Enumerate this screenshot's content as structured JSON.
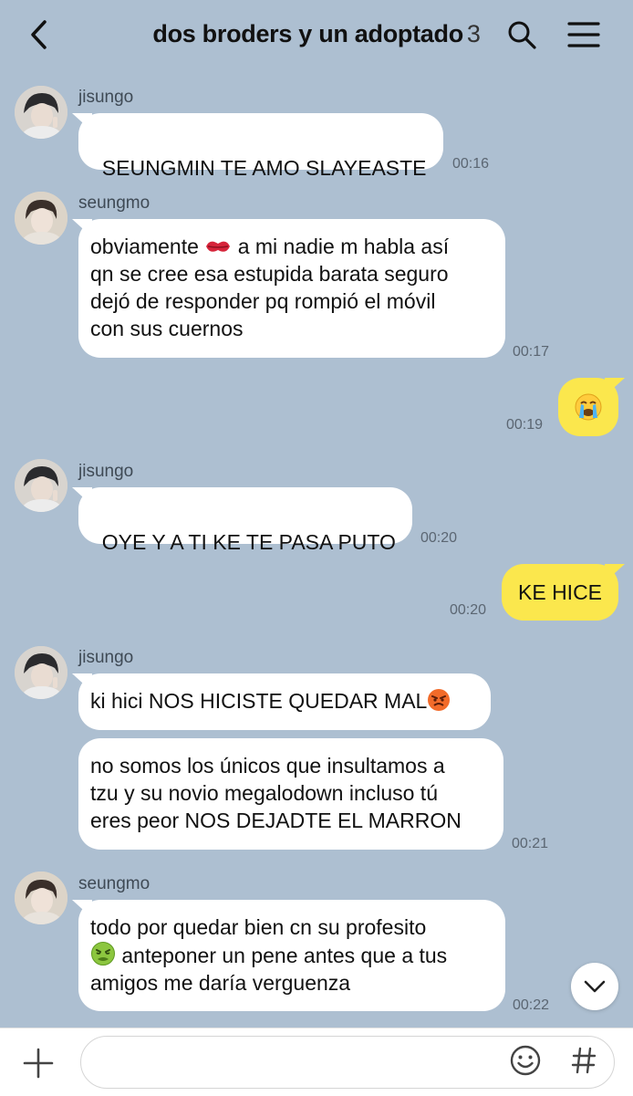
{
  "header": {
    "title": "dos broders y un adoptado",
    "member_count": "3"
  },
  "messages": [
    {
      "sender": "jisungo",
      "text": "SEUNGMIN TE AMO SLAYEASTE",
      "time": "00:16"
    },
    {
      "sender": "seungmo",
      "text_before_emoji": "obviamente ",
      "emoji": "kiss-mark",
      "text_after_emoji": " a mi nadie m habla así\nqn se cree esa estupida barata seguro\ndejó de responder pq rompió el móvil\ncon sus cuernos",
      "time": "00:17"
    },
    {
      "sender": "me",
      "emoji": "loudly-crying-face",
      "time": "00:19"
    },
    {
      "sender": "jisungo",
      "text": "OYE Y A TI KE TE PASA PUTO",
      "time": "00:20"
    },
    {
      "sender": "me",
      "text": "KE HICE",
      "time": "00:20"
    },
    {
      "sender": "jisungo",
      "text": "ki hici NOS HICISTE QUEDAR MAL",
      "emoji": "angry-face"
    },
    {
      "sender": "jisungo",
      "text": "no somos los únicos que insultamos a\ntzu y su novio megalodown incluso tú\neres peor NOS DEJADTE EL MARRON",
      "time": "00:21"
    },
    {
      "sender": "seungmo",
      "text_line1": "todo por quedar bien cn su profesito",
      "emoji": "nauseated-face",
      "text_after_emoji": " anteponer un pene antes que a tus\namigos me daría verguenza",
      "time": "00:22"
    }
  ],
  "composer": {
    "placeholder": ""
  },
  "colors": {
    "background": "#adbfd1",
    "my_bubble": "#fbe74d",
    "their_bubble": "#ffffff"
  },
  "icons": [
    "back-arrow-icon",
    "search-icon",
    "menu-icon",
    "chevron-down-icon",
    "plus-icon",
    "emoji-icon",
    "hashtag-icon"
  ]
}
